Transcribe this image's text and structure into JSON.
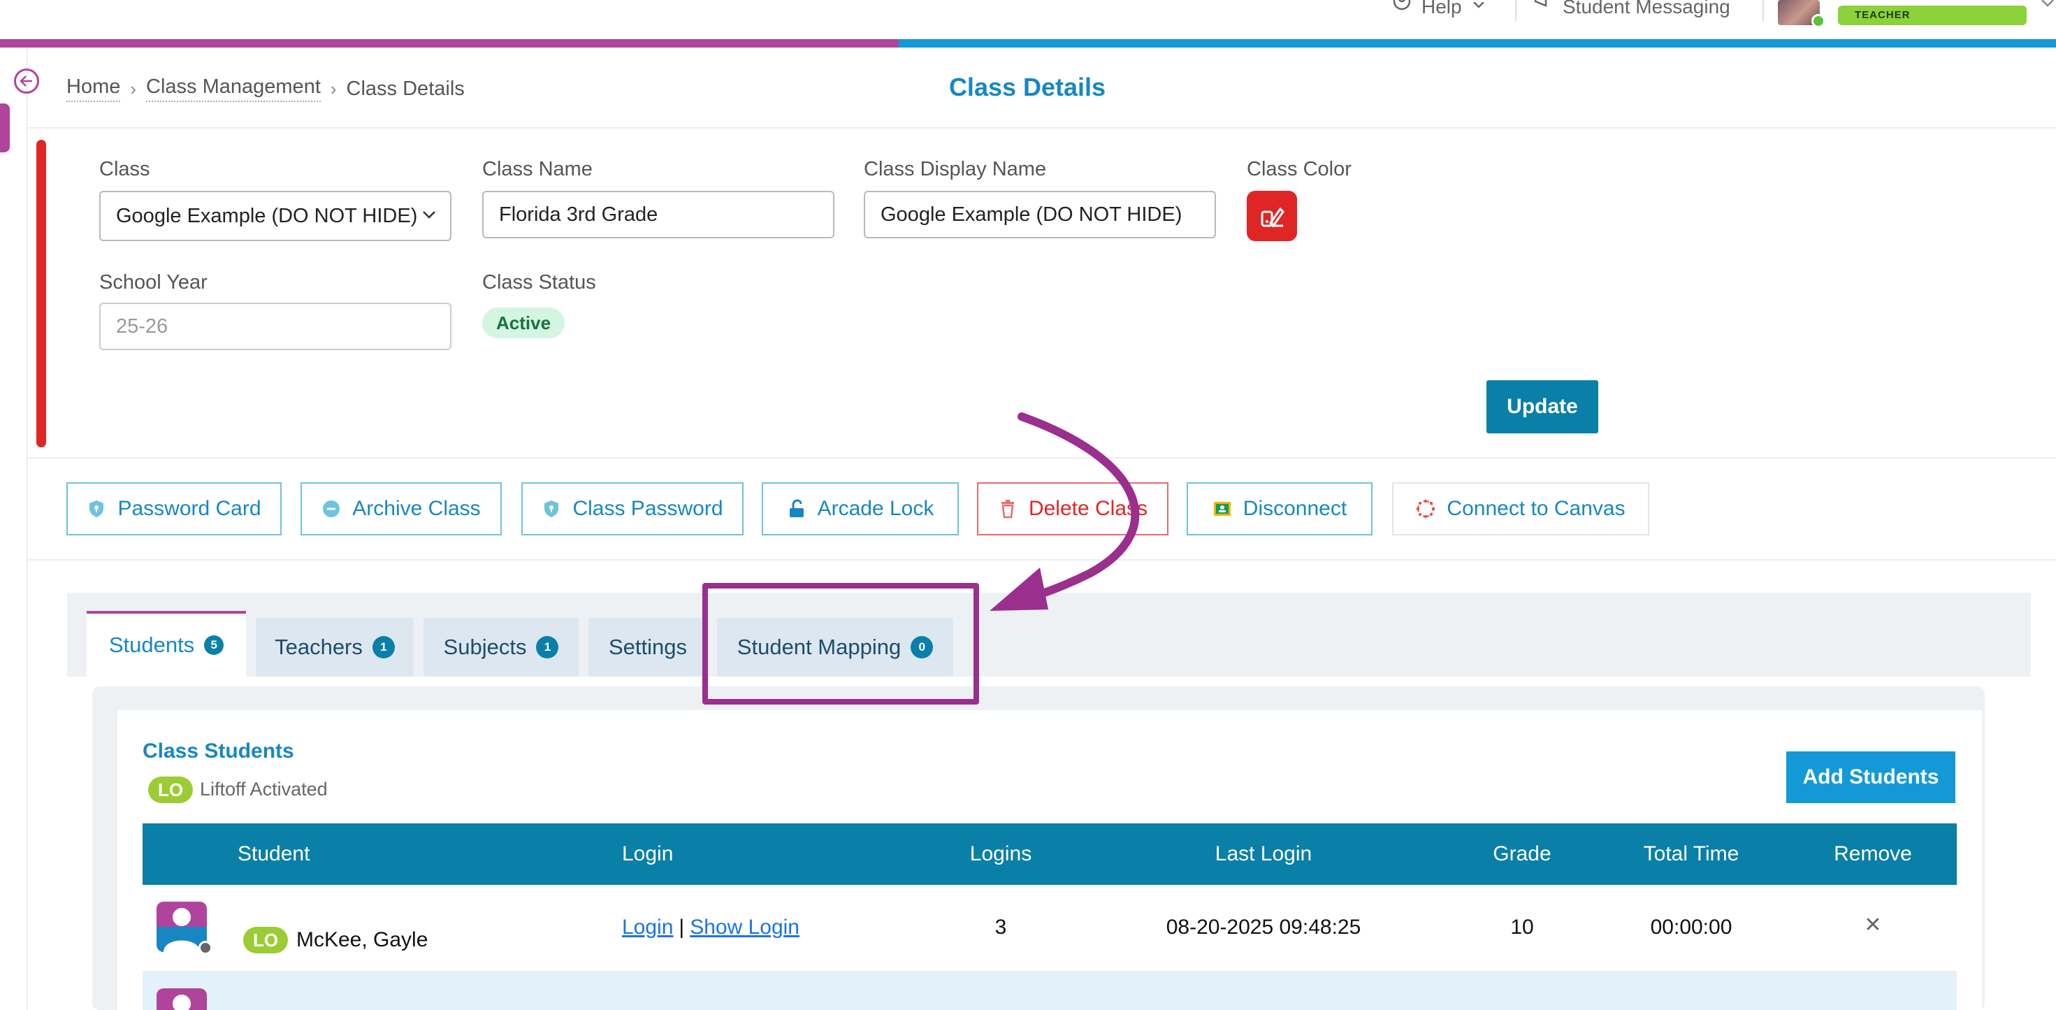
{
  "header": {
    "help_label": "Help",
    "messaging_label": "Student Messaging",
    "role_badge": "TEACHER"
  },
  "breadcrumb": {
    "home": "Home",
    "class_management": "Class Management",
    "current": "Class Details"
  },
  "page_title": "Class Details",
  "form": {
    "class_label": "Class",
    "class_value": "Google Example (DO NOT HIDE)",
    "class_name_label": "Class Name",
    "class_name_value": "Florida 3rd Grade",
    "display_name_label": "Class Display Name",
    "display_name_value": "Google Example (DO NOT HIDE)",
    "color_label": "Class Color",
    "color_value": "#e02525",
    "school_year_label": "School Year",
    "school_year_value": "25-26",
    "status_label": "Class Status",
    "status_value": "Active",
    "update_label": "Update"
  },
  "actions": [
    {
      "label": "Password Card",
      "icon": "shield-icon"
    },
    {
      "label": "Archive Class",
      "icon": "minus-circle-icon"
    },
    {
      "label": "Class Password",
      "icon": "shield-icon"
    },
    {
      "label": "Arcade Lock",
      "icon": "unlock-icon"
    },
    {
      "label": "Delete Class",
      "icon": "trash-icon"
    },
    {
      "label": "Disconnect",
      "icon": "google-classroom-icon"
    },
    {
      "label": "Connect to Canvas",
      "icon": "canvas-icon"
    }
  ],
  "tabs": [
    {
      "label": "Students",
      "count": "5"
    },
    {
      "label": "Teachers",
      "count": "1"
    },
    {
      "label": "Subjects",
      "count": "1"
    },
    {
      "label": "Settings",
      "count": ""
    },
    {
      "label": "Student Mapping",
      "count": "0"
    }
  ],
  "students_panel": {
    "title": "Class Students",
    "liftoff_badge": "LO",
    "liftoff_text": "Liftoff Activated",
    "add_button": "Add Students",
    "columns": [
      "Student",
      "Login",
      "Logins",
      "Last Login",
      "Grade",
      "Total Time",
      "Remove"
    ],
    "rows": [
      {
        "badge": "LO",
        "name": "McKee, Gayle",
        "login_link": "Login",
        "login_sep": "|",
        "show_login_link": "Show Login",
        "logins": "3",
        "last_login": "08-20-2025 09:48:25",
        "grade": "10",
        "total_time": "00:00:00",
        "remove": "✕"
      }
    ]
  },
  "colors": {
    "brand_purple": "#b0449c",
    "brand_blue": "#139ad6",
    "table_header": "#0a7fa8",
    "danger": "#e02525"
  }
}
